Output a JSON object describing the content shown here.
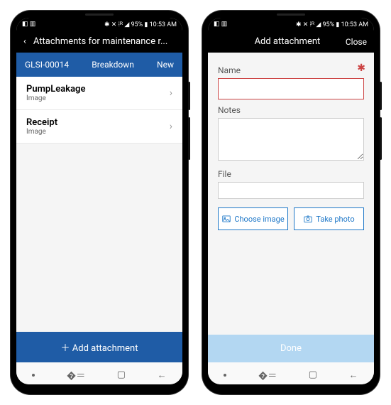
{
  "statusbar": {
    "left_icons": "◧ ▥",
    "right_text": "✱ ✕  ⁞ᴿ ◢ 95% ▮ 10:53 AM"
  },
  "screen1": {
    "header": {
      "title": "Attachments for maintenance r..."
    },
    "context": {
      "id": "GLSI-00014",
      "type": "Breakdown",
      "status": "New"
    },
    "items": [
      {
        "name": "PumpLeakage",
        "sub": "Image"
      },
      {
        "name": "Receipt",
        "sub": "Image"
      }
    ],
    "add_button": "Add attachment"
  },
  "screen2": {
    "header": {
      "title": "Add attachment",
      "close": "Close"
    },
    "labels": {
      "name": "Name",
      "notes": "Notes",
      "file": "File"
    },
    "values": {
      "name": "",
      "notes": "",
      "file": ""
    },
    "buttons": {
      "choose": "Choose image",
      "photo": "Take photo",
      "done": "Done"
    }
  },
  "nav": {
    "recent": "�＝",
    "home": "▢",
    "back": "←"
  }
}
